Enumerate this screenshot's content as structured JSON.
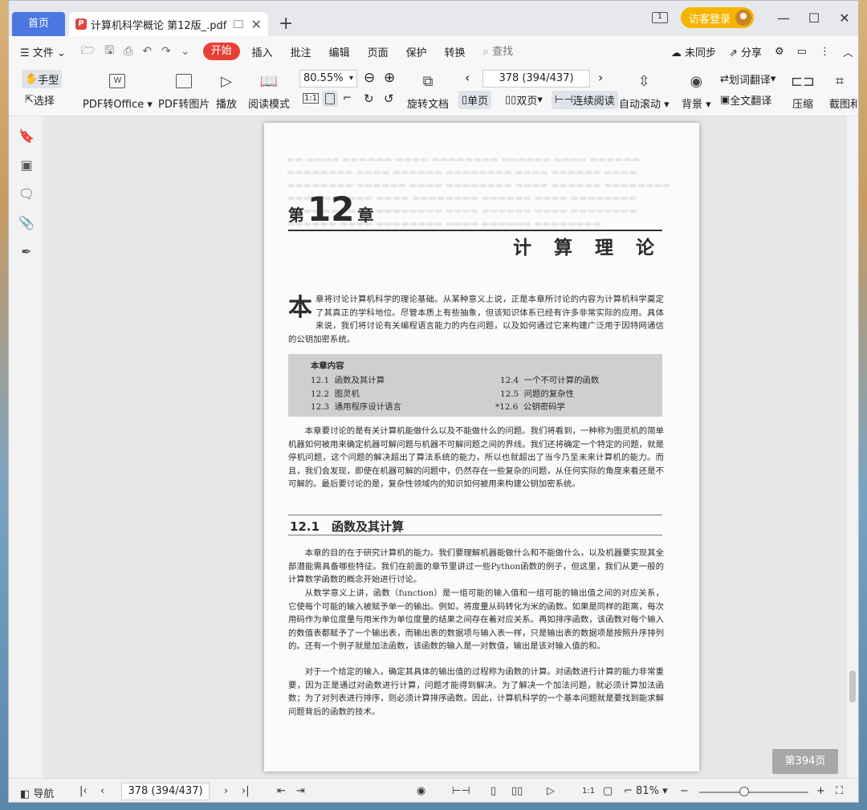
{
  "titlebar": {
    "home_tab": "首页",
    "doc_tab": "计算机科学概论 第12版_.pdf",
    "login": "访客登录"
  },
  "menubar": {
    "file": "文件",
    "tabs": [
      "开始",
      "插入",
      "批注",
      "编辑",
      "页面",
      "保护",
      "转换"
    ],
    "search_placeholder": "查找",
    "sync": "未同步",
    "share": "分享"
  },
  "toolbar": {
    "hand": "手型",
    "select": "选择",
    "to_office": "PDF转Office",
    "to_image": "PDF转图片",
    "play": "播放",
    "read_mode": "阅读模式",
    "zoom": "80.55%",
    "rotate": "旋转文档",
    "page_box": "378 (394/437)",
    "single": "单页",
    "double": "双页",
    "continuous": "连续阅读",
    "auto_scroll": "自动滚动",
    "background": "背景",
    "word_translate": "划词翻译",
    "full_translate": "全文翻译",
    "compress": "压缩",
    "screenshot": "截图和"
  },
  "document": {
    "chapter_prefix": "第",
    "chapter_num": "12",
    "chapter_suffix": "章",
    "chapter_title": "计 算 理 论",
    "intro_cap": "本",
    "intro": "章将讨论计算机科学的理论基础。从某种意义上说，正是本章所讨论的内容为计算机科学奠定了其真正的学科地位。尽管本质上有些抽象，但该知识体系已经有许多非常实际的应用。具体来说，我们将讨论有关编程语言能力的内在问题，以及如何通过它来构建广泛用于因特网通信的公钥加密系统。",
    "toc_heading": "本章内容",
    "toc": [
      {
        "num": "12.1",
        "title": "函数及其计算",
        "num2": "12.4",
        "title2": "一个不可计算的函数"
      },
      {
        "num": "12.2",
        "title": "图灵机",
        "num2": "12.5",
        "title2": "问题的复杂性"
      },
      {
        "num": "12.3",
        "title": "通用程序设计语言",
        "num2": "*12.6",
        "title2": "公钥密码学"
      }
    ],
    "para1": "本章要讨论的是有关计算机能做什么以及不能做什么的问题。我们将看到，一种称为图灵机的简单机器如何被用来确定机器可解问题与机器不可解问题之间的界线。我们还将确定一个特定的问题，就是停机问题，这个问题的解决超出了算法系统的能力，所以也就超出了当今乃至未来计算机的能力。而且，我们会发现，即使在机器可解的问题中，仍然存在一些复杂的问题，从任何实际的角度来看还是不可解的。最后要讨论的是，复杂性领域内的知识如何被用来构建公钥加密系统。",
    "section_title": "12.1　函数及其计算",
    "para2": "本章的目的在于研究计算机的能力。我们要理解机器能做什么和不能做什么，以及机器要实现其全部潜能需具备哪些特征。我们在前面的章节里讲过一些Python函数的例子，但这里，我们从更一般的计算数学函数的概念开始进行讨论。",
    "para3": "从数学意义上讲，函数（function）是一组可能的输入值和一组可能的输出值之间的对应关系，它使每个可能的输入被赋予单一的输出。例如，将度量从码转化为米的函数。如果是同样的距离，每次用码作为单位度量与用米作为单位度量的结果之间存在着对应关系。再如排序函数，该函数对每个输入的数值表都赋予了一个输出表，而输出表的数据项与输入表一样，只是输出表的数据项是按照升序排列的。还有一个例子就是加法函数，该函数的输入是一对数值，输出是该对输入值的和。",
    "para4": "对于一个给定的输入，确定其具体的输出值的过程称为函数的计算。对函数进行计算的能力非常重要，因为正是通过对函数进行计算，问题才能得到解决。为了解决一个加法问题，就必须计算加法函数；为了对列表进行排序，则必须计算排序函数。因此，计算机科学的一个基本问题就是要找到能求解问题背后的函数的技术。"
  },
  "statusbar": {
    "nav": "导航",
    "page_box": "378 (394/437)",
    "zoom": "81%",
    "page_badge": "第394页"
  }
}
